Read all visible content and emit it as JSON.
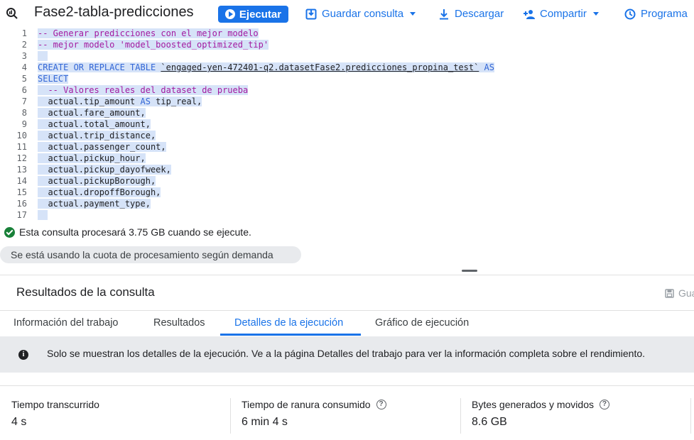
{
  "toolbar": {
    "title": "Fase2-tabla-predicciones",
    "run_label": "Ejecutar",
    "save_query_label": "Guardar consulta",
    "download_label": "Descargar",
    "share_label": "Compartir",
    "schedule_label": "Programa",
    "accent_color": "#1a73e8"
  },
  "editor": {
    "lines": [
      {
        "n": "1",
        "text": "-- Generar predicciones con el mejor modelo",
        "kind": "comment"
      },
      {
        "n": "2",
        "text": "-- mejor modelo 'model_boosted_optimized_tip'",
        "kind": "comment"
      },
      {
        "n": "3",
        "text": "",
        "kind": "blank"
      },
      {
        "n": "4",
        "text": "CREATE OR REPLACE TABLE `engaged-yen-472401-q2.datasetFase2.predicciones_propina_test` AS",
        "kind": "create"
      },
      {
        "n": "5",
        "text": "SELECT",
        "kind": "keyword"
      },
      {
        "n": "6",
        "text": "  -- Valores reales del dataset de prueba",
        "kind": "comment"
      },
      {
        "n": "7",
        "text": "  actual.tip_amount AS tip_real,",
        "kind": "alias"
      },
      {
        "n": "8",
        "text": "  actual.fare_amount,",
        "kind": "code"
      },
      {
        "n": "9",
        "text": "  actual.total_amount,",
        "kind": "code"
      },
      {
        "n": "10",
        "text": "  actual.trip_distance,",
        "kind": "code"
      },
      {
        "n": "11",
        "text": "  actual.passenger_count,",
        "kind": "code"
      },
      {
        "n": "12",
        "text": "  actual.pickup_hour,",
        "kind": "code"
      },
      {
        "n": "13",
        "text": "  actual.pickup_dayofweek,",
        "kind": "code"
      },
      {
        "n": "14",
        "text": "  actual.pickupBorough,",
        "kind": "code"
      },
      {
        "n": "15",
        "text": "  actual.dropoffBorough,",
        "kind": "code"
      },
      {
        "n": "16",
        "text": "  actual.payment_type,",
        "kind": "code"
      },
      {
        "n": "17",
        "text": "  ",
        "kind": "code"
      }
    ]
  },
  "status": {
    "validation_text": "Esta consulta procesará 3.75 GB cuando se ejecute.",
    "quota_chip": "Se está usando la cuota de procesamiento según demanda"
  },
  "results": {
    "title": "Resultados de la consulta",
    "save_label": "Gua",
    "tabs": [
      "Información del trabajo",
      "Resultados",
      "Detalles de la ejecución",
      "Gráfico de ejecución"
    ],
    "active_tab": "Detalles de la ejecución",
    "info_text": "Solo se muestran los detalles de la ejecución. Ve a la página Detalles del trabajo para ver la información completa sobre el rendimiento.",
    "stats": [
      {
        "label": "Tiempo transcurrido",
        "value": "4 s",
        "help": false
      },
      {
        "label": "Tiempo de ranura consumido",
        "value": "6 min 4 s",
        "help": true
      },
      {
        "label": "Bytes generados y movidos",
        "value": "8.6 GB",
        "help": true
      }
    ]
  }
}
